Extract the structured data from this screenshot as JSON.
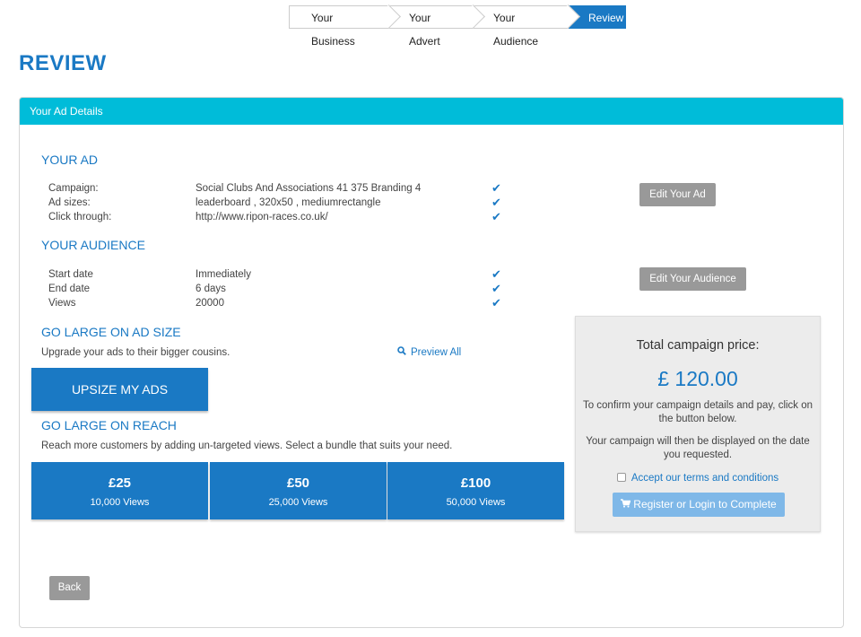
{
  "stepper": {
    "steps": [
      "Your Business",
      "Your Advert",
      "Your Audience",
      "Review"
    ]
  },
  "page_title": "REVIEW",
  "panel_title": "Your Ad Details",
  "your_ad": {
    "title": "YOUR AD",
    "rows": [
      {
        "label": "Campaign:",
        "value": "Social Clubs And Associations 41 375 Branding 4"
      },
      {
        "label": "Ad sizes:",
        "value": "leaderboard , 320x50 , mediumrectangle"
      },
      {
        "label": "Click through:",
        "value": "http://www.ripon-races.co.uk/"
      }
    ],
    "edit_label": "Edit Your Ad"
  },
  "your_audience": {
    "title": "YOUR AUDIENCE",
    "rows": [
      {
        "label": "Start date",
        "value": "Immediately"
      },
      {
        "label": "End date",
        "value": "6 days"
      },
      {
        "label": "Views",
        "value": "20000"
      }
    ],
    "edit_label": "Edit Your Audience"
  },
  "ad_size": {
    "title": "GO LARGE ON AD SIZE",
    "subtitle": "Upgrade your ads to their bigger cousins.",
    "preview_label": "Preview All",
    "upsize_label": "UPSIZE MY ADS"
  },
  "reach": {
    "title": "GO LARGE ON REACH",
    "subtitle": "Reach more customers by adding un-targeted views. Select a bundle that suits your need.",
    "bundles": [
      {
        "price": "£25",
        "views": "10,000 Views"
      },
      {
        "price": "£50",
        "views": "25,000 Views"
      },
      {
        "price": "£100",
        "views": "50,000 Views"
      }
    ]
  },
  "summary": {
    "title": "Total campaign price:",
    "amount": "£ 120.00",
    "confirm_text": "To confirm your campaign details and pay, click on the button below.",
    "display_text": "Your campaign will then be displayed on the date you requested.",
    "terms_label": "Accept our terms and conditions",
    "register_label": "Register or Login to Complete"
  },
  "back_label": "Back",
  "colors": {
    "primary": "#1a79c4",
    "header": "#00bcd9",
    "grey_button": "#999999",
    "register_button": "#7fb8e8"
  }
}
